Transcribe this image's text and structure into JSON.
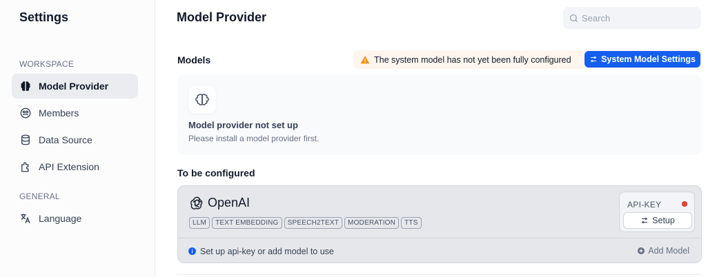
{
  "sidebar": {
    "title": "Settings",
    "workspace_label": "WORKSPACE",
    "general_label": "GENERAL",
    "items": [
      {
        "label": "Model Provider",
        "icon": "brain-icon"
      },
      {
        "label": "Members",
        "icon": "members-icon"
      },
      {
        "label": "Data Source",
        "icon": "database-icon"
      },
      {
        "label": "API Extension",
        "icon": "puzzle-icon"
      }
    ],
    "general_items": [
      {
        "label": "Language",
        "icon": "translate-icon"
      }
    ]
  },
  "header": {
    "title": "Model Provider",
    "search_placeholder": "Search"
  },
  "models": {
    "label": "Models",
    "warning": "The system model has not yet been fully configured",
    "system_button": "System Model Settings",
    "empty_title": "Model provider not set up",
    "empty_desc": "Please install a model provider first."
  },
  "to_be_configured": {
    "label": "To be configured",
    "provider": {
      "name": "OpenAI",
      "tags": [
        "LLM",
        "TEXT EMBEDDING",
        "SPEECH2TEXT",
        "MODERATION",
        "TTS"
      ],
      "api_key_label": "API-KEY",
      "setup_label": "Setup",
      "footer_info": "Set up api-key or add model to use",
      "add_model_label": "Add Model"
    }
  },
  "colors": {
    "accent": "#155eef",
    "warning": "#f79009",
    "status_dot": "#f04438"
  }
}
